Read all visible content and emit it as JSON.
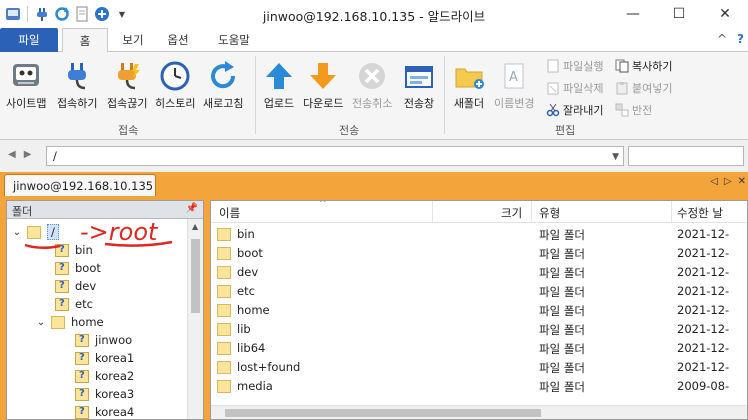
{
  "window": {
    "title": "jinwoo@192.168.10.135 - 알드라이브"
  },
  "ribbon_tabs": [
    "파일",
    "홈",
    "보기",
    "옵션",
    "도움말"
  ],
  "home_ribbon": {
    "connect_group": {
      "label": "접속",
      "buttons": [
        "사이트맵",
        "접속하기",
        "접속끊기",
        "히스토리",
        "새로고침"
      ]
    },
    "transfer_group": {
      "label": "전송",
      "buttons": [
        "업로드",
        "다운로드",
        "전송취소",
        "전송창"
      ]
    },
    "edit_group": {
      "label": "편집",
      "buttons": [
        "새폴더",
        "이름변경"
      ],
      "small": [
        "파일실행",
        "파일삭제",
        "잘라내기",
        "복사하기",
        "붙여넣기",
        "반전"
      ]
    }
  },
  "address": {
    "path": "/"
  },
  "session_tab": "jinwoo@192.168.10.135",
  "folder_pane": {
    "header": "폴더",
    "root": "/",
    "items": [
      "bin",
      "boot",
      "dev",
      "etc",
      "home",
      "jinwoo",
      "korea1",
      "korea2",
      "korea3",
      "korea4"
    ]
  },
  "annotation": "->root",
  "file_list": {
    "columns": [
      "이름",
      "크기",
      "유형",
      "수정한 날"
    ],
    "rows": [
      {
        "name": "bin",
        "type": "파일 폴더",
        "date": "2021-12-"
      },
      {
        "name": "boot",
        "type": "파일 폴더",
        "date": "2021-12-"
      },
      {
        "name": "dev",
        "type": "파일 폴더",
        "date": "2021-12-"
      },
      {
        "name": "etc",
        "type": "파일 폴더",
        "date": "2021-12-"
      },
      {
        "name": "home",
        "type": "파일 폴더",
        "date": "2021-12-"
      },
      {
        "name": "lib",
        "type": "파일 폴더",
        "date": "2021-12-"
      },
      {
        "name": "lib64",
        "type": "파일 폴더",
        "date": "2021-12-"
      },
      {
        "name": "lost+found",
        "type": "파일 폴더",
        "date": "2021-12-"
      },
      {
        "name": "media",
        "type": "파일 폴더",
        "date": "2009-08-"
      }
    ]
  },
  "colors": {
    "file_tab": "#2b61b6",
    "session_bg": "#f3a53c",
    "annotation": "#e0261e",
    "folder": "#fce59a"
  }
}
